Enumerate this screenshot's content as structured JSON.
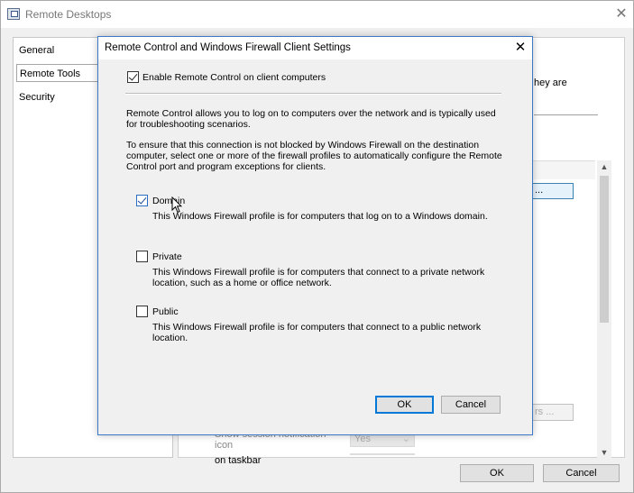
{
  "window": {
    "title": "Remote Desktops",
    "close_glyph": "✕"
  },
  "nav": {
    "items": [
      {
        "label": "General",
        "selected": false
      },
      {
        "label": "Remote Tools",
        "selected": true
      },
      {
        "label": "Security",
        "selected": false
      }
    ]
  },
  "background": {
    "partial_text": "hey are",
    "edit_button_partial": "...",
    "faded_button_partial": "rs ...",
    "setting_label_top_cut": "Show session notification icon",
    "setting_label_bottom": "on taskbar",
    "setting_value": "Yes",
    "scroll_up_glyph": "▲",
    "scroll_down_glyph": "▼"
  },
  "footer": {
    "ok_label": "OK",
    "cancel_label": "Cancel"
  },
  "dialog": {
    "title": "Remote Control and Windows Firewall Client Settings",
    "close_glyph": "✕",
    "enable_label": "Enable Remote Control on client computers",
    "enable_checked": true,
    "description_1": "Remote Control allows you to log on to computers over the network and is typically used for troubleshooting scenarios.",
    "description_2": "To ensure that this connection is not blocked by Windows Firewall on the destination computer, select one or more of the firewall profiles to automatically configure the Remote Control port and program exceptions for clients.",
    "profiles": [
      {
        "label": "Domain",
        "checked": true,
        "description": "This Windows Firewall profile is for computers that log on to a Windows domain."
      },
      {
        "label": "Private",
        "checked": false,
        "description": "This Windows Firewall profile is for computers that connect to a private network location, such as a home or office network."
      },
      {
        "label": "Public",
        "checked": false,
        "description": "This Windows Firewall profile is for computers that connect to a public network location."
      }
    ],
    "ok_label": "OK",
    "cancel_label": "Cancel"
  },
  "colors": {
    "accent": "#0078d7",
    "dialog_border": "#3b78c7"
  }
}
